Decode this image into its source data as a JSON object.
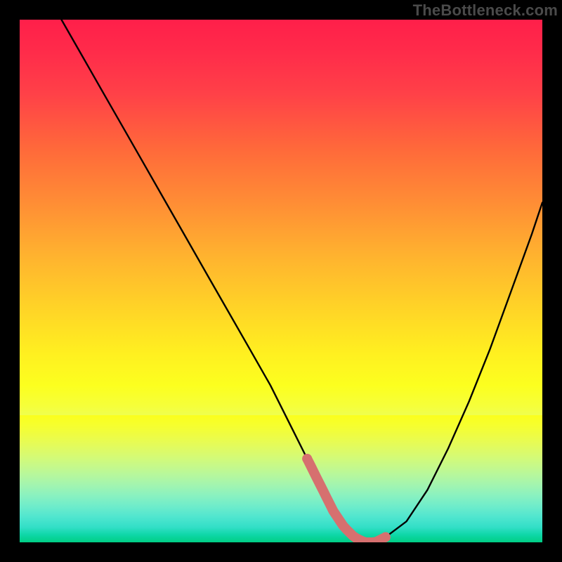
{
  "watermark": "TheBottleneck.com",
  "chart_data": {
    "type": "line",
    "title": "",
    "xlabel": "",
    "ylabel": "",
    "ylim": [
      0,
      100
    ],
    "xlim": [
      0,
      100
    ],
    "series": [
      {
        "name": "bottleneck-curve",
        "x": [
          8,
          12,
          16,
          20,
          24,
          28,
          32,
          36,
          40,
          44,
          48,
          52,
          54,
          56,
          58,
          60,
          62,
          64,
          66,
          68,
          70,
          74,
          78,
          82,
          86,
          90,
          94,
          98,
          100
        ],
        "y": [
          100,
          93,
          86,
          79,
          72,
          65,
          58,
          51,
          44,
          37,
          30,
          22,
          18,
          14,
          10,
          6,
          3,
          1,
          0,
          0,
          1,
          4,
          10,
          18,
          27,
          37,
          48,
          59,
          65
        ]
      }
    ],
    "bottom_band_start_pct": 75.7,
    "highlight": {
      "start_pct": 55,
      "end_pct": 70,
      "color": "#d6706f"
    }
  },
  "colors": {
    "curve": "#000000",
    "highlight_stroke": "#d6706f",
    "background_top": "#ff1f4a",
    "background_bottom": "#00ce84",
    "frame": "#000000",
    "watermark": "#4a4a4a"
  }
}
